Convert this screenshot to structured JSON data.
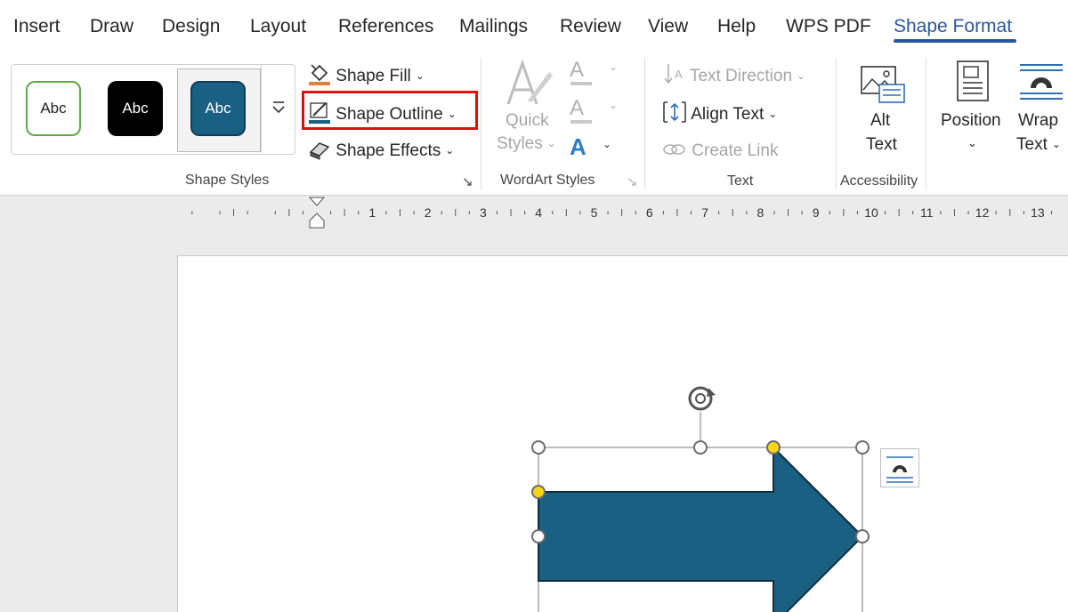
{
  "tabs": [
    "Insert",
    "Draw",
    "Design",
    "Layout",
    "References",
    "Mailings",
    "Review",
    "View",
    "Help",
    "WPS PDF",
    "Shape Format"
  ],
  "active_tab": "Shape Format",
  "shape_styles": {
    "tiles": [
      "Abc",
      "Abc",
      "Abc"
    ],
    "shape_fill": "Shape Fill",
    "shape_outline": "Shape Outline",
    "shape_effects": "Shape Effects",
    "group_label": "Shape Styles"
  },
  "wordart": {
    "quick": "Quick",
    "styles": "Styles",
    "group_label": "WordArt Styles"
  },
  "text_group": {
    "text_direction": "Text Direction",
    "align_text": "Align Text",
    "create_link": "Create Link",
    "group_label": "Text"
  },
  "accessibility": {
    "alt": "Alt",
    "text": "Text",
    "group_label": "Accessibility"
  },
  "arrange": {
    "position": "Position",
    "wrap": "Wrap",
    "wrap_text": "Text"
  },
  "ruler": {
    "numbers": [
      "1",
      "2",
      "3",
      "4",
      "5",
      "6",
      "7",
      "8",
      "9",
      "10",
      "11",
      "12",
      "13"
    ]
  },
  "colors": {
    "accent_blue": "#2b579a",
    "shape_fill": "#1a6082",
    "highlight_red": "#e01010",
    "handle_yellow": "#f5d516",
    "tile_green_outline": "#5fa84a"
  }
}
